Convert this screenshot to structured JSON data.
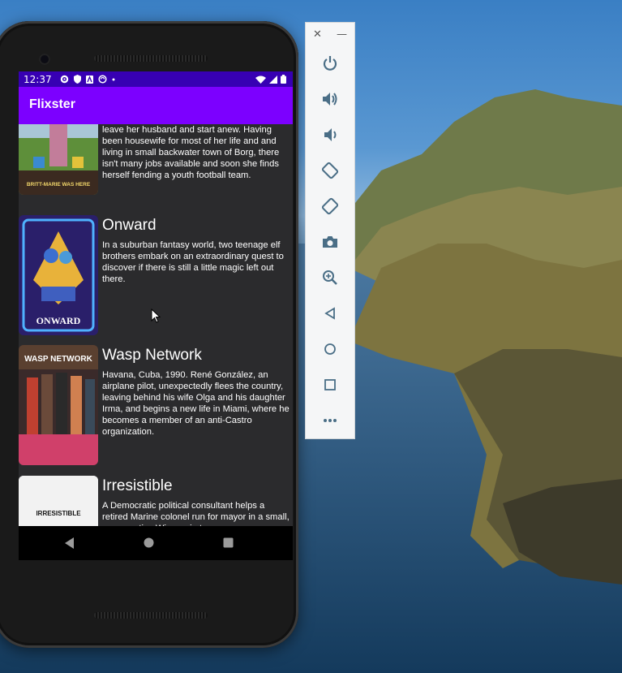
{
  "status_bar": {
    "time": "12:37"
  },
  "app_bar": {
    "title": "Flixster"
  },
  "movies": [
    {
      "title": "",
      "overview": "leave her husband and start anew. Having been housewife for most of her life and and living in small backwater town of Borg, there isn't many jobs available and soon she finds herself fending a youth football team.",
      "poster_caption": "BRITT-MARIE WAS HERE"
    },
    {
      "title": "Onward",
      "overview": "In a suburban fantasy world, two teenage elf brothers embark on an extraordinary quest to discover if there is still a little magic left out there.",
      "poster_caption": "ONWARD"
    },
    {
      "title": "Wasp Network",
      "overview": "Havana, Cuba, 1990. René González, an airplane pilot, unexpectedly flees the country, leaving behind his wife Olga and his daughter Irma, and begins a new life in Miami, where he becomes a member of an anti-Castro organization.",
      "poster_caption": "WASP NETWORK"
    },
    {
      "title": "Irresistible",
      "overview": "A Democratic political consultant helps a retired Marine colonel run for mayor in a small, conservative Wisconsin town.",
      "poster_caption": "IRRESISTIBLE"
    }
  ],
  "emulator_toolbar": {
    "window_buttons": [
      "close-icon",
      "minimize-icon"
    ],
    "buttons": [
      "power-icon",
      "volume-up-icon",
      "volume-down-icon",
      "rotate-left-icon",
      "rotate-right-icon",
      "camera-icon",
      "zoom-icon",
      "back-icon",
      "home-icon",
      "overview-icon",
      "more-icon"
    ]
  },
  "nav_bar": {
    "buttons": [
      "back-icon",
      "home-icon",
      "recents-icon"
    ]
  },
  "colors": {
    "status_bar": "#3700b3",
    "app_bar": "#7c00ff",
    "list_bg": "#2b2b2d"
  }
}
